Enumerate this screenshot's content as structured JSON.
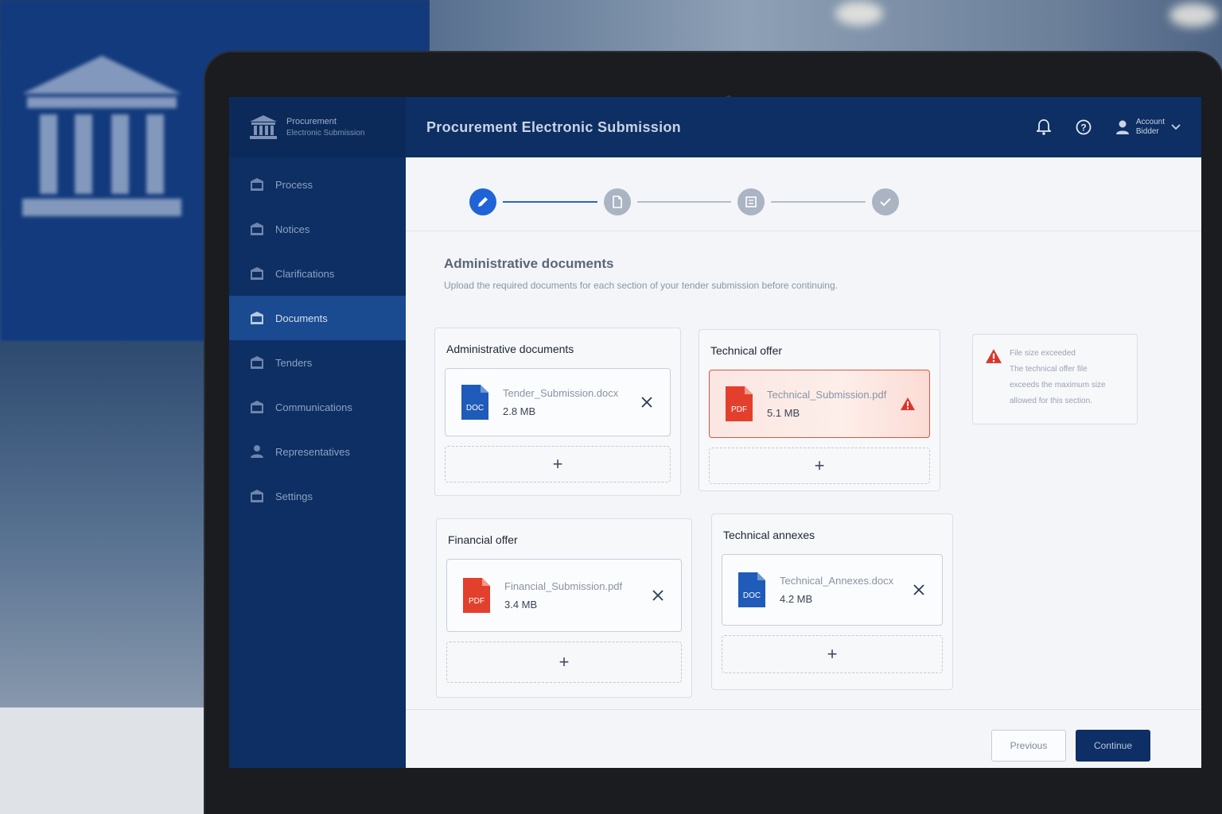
{
  "app": {
    "brand_line1": "Procurement",
    "brand_line2": "Electronic Submission",
    "header_title": "Procurement Electronic Submission"
  },
  "header": {
    "user_name": "Account",
    "user_role": "Bidder"
  },
  "sidebar": {
    "items": [
      {
        "label": "Process",
        "icon": "building-icon",
        "active": false
      },
      {
        "label": "Notices",
        "icon": "building-icon",
        "active": false
      },
      {
        "label": "Clarifications",
        "icon": "building-icon",
        "active": false
      },
      {
        "label": "Documents",
        "icon": "building-icon",
        "active": true
      },
      {
        "label": "Tenders",
        "icon": "building-icon",
        "active": false
      },
      {
        "label": "Communications",
        "icon": "building-icon",
        "active": false
      },
      {
        "label": "Representatives",
        "icon": "person-icon",
        "active": false
      },
      {
        "label": "Settings",
        "icon": "building-icon",
        "active": false
      }
    ]
  },
  "stepper": {
    "steps": [
      {
        "icon": "pencil-icon",
        "state": "active"
      },
      {
        "icon": "document-icon",
        "state": "pending"
      },
      {
        "icon": "list-icon",
        "state": "pending"
      },
      {
        "icon": "check-icon",
        "state": "pending"
      }
    ]
  },
  "main": {
    "section_title": "Administrative documents",
    "section_desc": "Upload the required documents for each section of your tender submission before continuing."
  },
  "cards": [
    {
      "title": "Administrative documents",
      "file": {
        "type_label": "DOC",
        "name": "Tender_Submission.docx",
        "size": "2.8 MB",
        "status": "ok"
      }
    },
    {
      "title": "Technical offer",
      "file": {
        "type_label": "PDF",
        "name": "Technical_Submission.pdf",
        "size": "5.1 MB",
        "status": "error"
      }
    },
    {
      "title": "Financial offer",
      "file": {
        "type_label": "PDF",
        "name": "Financial_Submission.pdf",
        "size": "3.4 MB",
        "status": "ok"
      }
    },
    {
      "title": "Technical annexes",
      "file": {
        "type_label": "DOC",
        "name": "Technical_Annexes.docx",
        "size": "4.2 MB",
        "status": "ok"
      }
    }
  ],
  "dropzone_symbol": "+",
  "alert": {
    "title": "File size exceeded",
    "line1": "The technical offer file",
    "line2": "exceeds the maximum size",
    "line3": "allowed for this section."
  },
  "footer": {
    "secondary_label": "Previous",
    "primary_label": "Continue"
  },
  "colors": {
    "brand_navy": "#0d2f63",
    "accent_blue": "#1f63d6",
    "doc_blue": "#1f5bb8",
    "pdf_red": "#e2402c",
    "error_red": "#e0533f"
  }
}
